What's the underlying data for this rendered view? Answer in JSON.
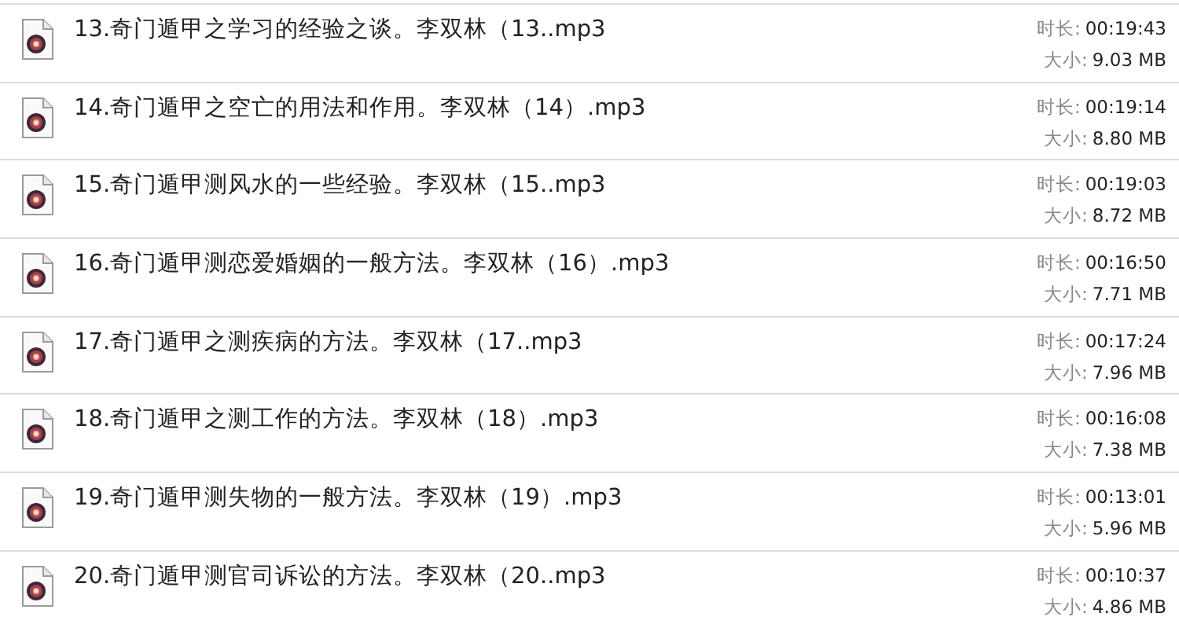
{
  "files": [
    {
      "name": "13.奇门遁甲之学习的经验之谈。李双林（13..mp3",
      "duration_label": "时长:",
      "duration": "00:19:43",
      "size_label": "大小:",
      "size": "9.03 MB"
    },
    {
      "name": "14.奇门遁甲之空亡的用法和作用。李双林（14）.mp3",
      "duration_label": "时长:",
      "duration": "00:19:14",
      "size_label": "大小:",
      "size": "8.80 MB"
    },
    {
      "name": "15.奇门遁甲测风水的一些经验。李双林（15..mp3",
      "duration_label": "时长:",
      "duration": "00:19:03",
      "size_label": "大小:",
      "size": "8.72 MB"
    },
    {
      "name": "16.奇门遁甲测恋爱婚姻的一般方法。李双林（16）.mp3",
      "duration_label": "时长:",
      "duration": "00:16:50",
      "size_label": "大小:",
      "size": "7.71 MB"
    },
    {
      "name": "17.奇门遁甲之测疾病的方法。李双林（17..mp3",
      "duration_label": "时长:",
      "duration": "00:17:24",
      "size_label": "大小:",
      "size": "7.96 MB"
    },
    {
      "name": "18.奇门遁甲之测工作的方法。李双林（18）.mp3",
      "duration_label": "时长:",
      "duration": "00:16:08",
      "size_label": "大小:",
      "size": "7.38 MB"
    },
    {
      "name": "19.奇门遁甲测失物的一般方法。李双林（19）.mp3",
      "duration_label": "时长:",
      "duration": "00:13:01",
      "size_label": "大小:",
      "size": "5.96 MB"
    },
    {
      "name": "20.奇门遁甲测官司诉讼的方法。李双林（20..mp3",
      "duration_label": "时长:",
      "duration": "00:10:37",
      "size_label": "大小:",
      "size": "4.86 MB"
    }
  ]
}
